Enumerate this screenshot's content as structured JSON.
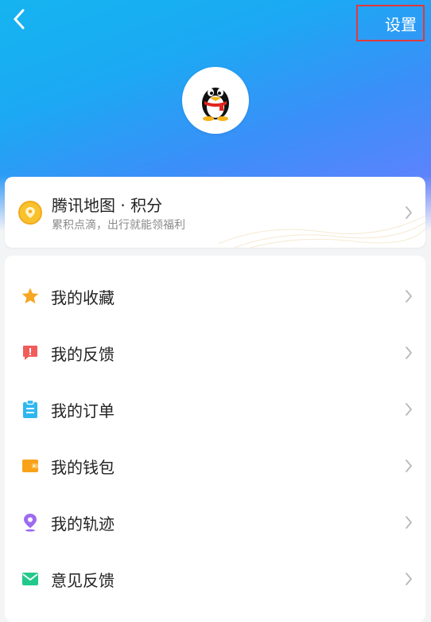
{
  "header": {
    "settings_label": "设置",
    "back_icon": "chevron-left-icon",
    "avatar_icon": "qq-penguin-icon"
  },
  "points_card": {
    "title": "腾讯地图 · 积分",
    "subtitle": "累积点滴，出行就能领福利",
    "icon": "coin-icon"
  },
  "menu": {
    "items": [
      {
        "label": "我的收藏",
        "icon": "star-icon",
        "color": "#f6a623"
      },
      {
        "label": "我的反馈",
        "icon": "feedback-alert-icon",
        "color": "#f25b5b"
      },
      {
        "label": "我的订单",
        "icon": "clipboard-icon",
        "color": "#2fb8f0"
      },
      {
        "label": "我的钱包",
        "icon": "wallet-icon",
        "color": "#f8a21a"
      },
      {
        "label": "我的轨迹",
        "icon": "location-pin-icon",
        "color": "#9c6bf0"
      },
      {
        "label": "意见反馈",
        "icon": "mail-icon",
        "color": "#22c98b"
      }
    ]
  },
  "colors": {
    "hero_start": "#15b4f0",
    "hero_end": "#6d7cff",
    "settings_highlight": "#e2393b"
  }
}
